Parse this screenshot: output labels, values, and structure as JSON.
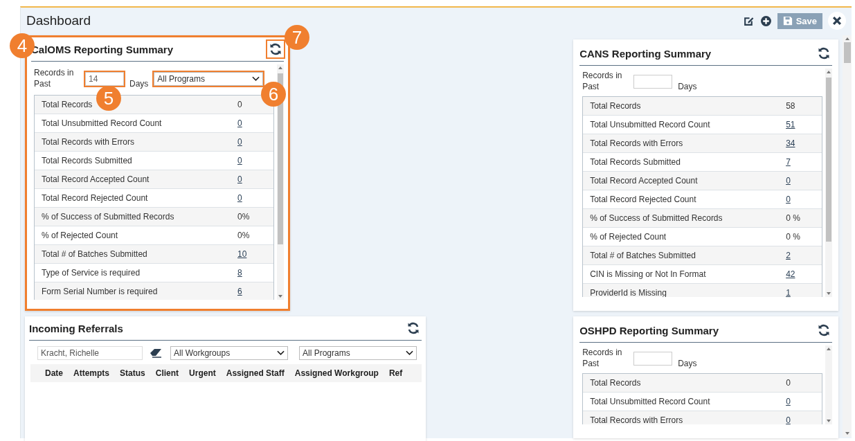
{
  "page": {
    "title": "Dashboard",
    "save_label": "Save"
  },
  "left_widgets": [
    {
      "kind": "summary",
      "title": "CalOMS Reporting Summary",
      "highlighted": true,
      "refresh_highlighted": true,
      "records_label": "Records in Past",
      "days_value": "14",
      "days_highlighted": true,
      "days_label": "Days",
      "program": "All Programs",
      "program_highlighted": true,
      "widget_badge": "4",
      "days_badge": "5",
      "program_badge": "6",
      "refresh_badge": "7",
      "rows": [
        {
          "label": "Total Records",
          "value": "0",
          "link": false
        },
        {
          "label": "Total Unsubmitted Record Count",
          "value": "0",
          "link": true
        },
        {
          "label": "Total Records with Errors",
          "value": "0",
          "link": true
        },
        {
          "label": "Total Records Submitted",
          "value": "0",
          "link": true
        },
        {
          "label": "Total Record Accepted Count",
          "value": "0",
          "link": true
        },
        {
          "label": "Total Record Rejected Count",
          "value": "0",
          "link": true
        },
        {
          "label": "% of Success of Submitted Records",
          "value": "0%",
          "link": false
        },
        {
          "label": "% of Rejected Count",
          "value": "0%",
          "link": false
        },
        {
          "label": "Total # of Batches Submitted",
          "value": "10",
          "link": true
        },
        {
          "label": "Type of Service is required",
          "value": "8",
          "link": true
        },
        {
          "label": "Form Serial Number is required",
          "value": "6",
          "link": true
        }
      ]
    },
    {
      "kind": "referrals",
      "title": "Incoming Referrals",
      "staff": "Kracht, Richelle",
      "workgroup": "All Workgroups",
      "program": "All Programs",
      "columns": [
        "Date",
        "Attempts",
        "Status",
        "Client",
        "Urgent",
        "Assigned Staff",
        "Assigned Workgroup",
        "Ref"
      ]
    }
  ],
  "right_widgets": [
    {
      "kind": "summary",
      "title": "CANS Reporting Summary",
      "highlighted": false,
      "refresh_highlighted": false,
      "records_label": "Records in Past",
      "days_highlighted": false,
      "days_label": "Days",
      "rows": [
        {
          "label": "Total Records",
          "value": "58",
          "link": false
        },
        {
          "label": "Total Unsubmitted Record Count",
          "value": "51",
          "link": true
        },
        {
          "label": "Total Records with Errors",
          "value": "34",
          "link": true
        },
        {
          "label": "Total Records Submitted",
          "value": "7",
          "link": true
        },
        {
          "label": "Total Record Accepted Count",
          "value": "0",
          "link": true
        },
        {
          "label": "Total Record Rejected Count",
          "value": "0",
          "link": true
        },
        {
          "label": "% of Success of Submitted Records",
          "value": "0 %",
          "link": false
        },
        {
          "label": "% of Rejected Count",
          "value": "0 %",
          "link": false
        },
        {
          "label": "Total # of Batches Submitted",
          "value": "2",
          "link": true
        },
        {
          "label": "CIN is Missing or Not In Format",
          "value": "42",
          "link": true
        },
        {
          "label": "ProviderId is Missing",
          "value": "1",
          "link": true
        }
      ]
    },
    {
      "kind": "summary",
      "title": "OSHPD Reporting Summary",
      "highlighted": false,
      "refresh_highlighted": false,
      "records_label": "Records in Past",
      "days_highlighted": false,
      "days_label": "Days",
      "rows": [
        {
          "label": "Total Records",
          "value": "0",
          "link": false
        },
        {
          "label": "Total Unsubmitted Record Count",
          "value": "0",
          "link": true
        },
        {
          "label": "Total Records with Errors",
          "value": "0",
          "link": true
        }
      ]
    }
  ]
}
